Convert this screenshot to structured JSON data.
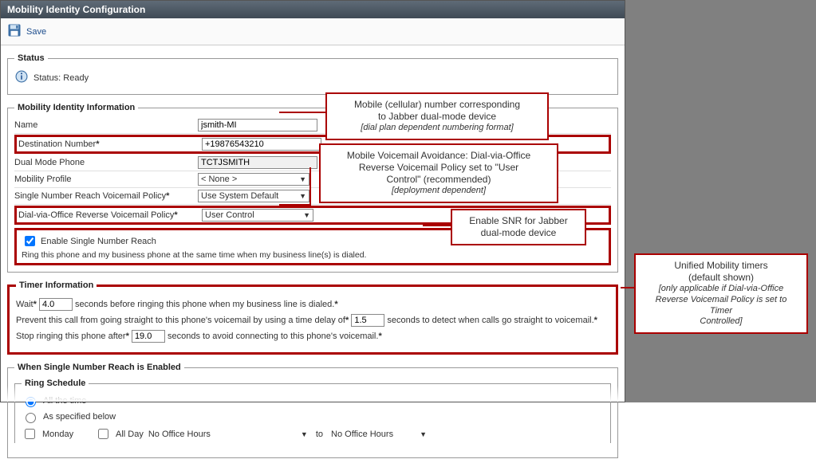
{
  "window": {
    "title": "Mobility Identity Configuration"
  },
  "toolbar": {
    "save_label": "Save"
  },
  "status": {
    "legend": "Status",
    "text": "Status: Ready"
  },
  "identity": {
    "legend": "Mobility Identity Information",
    "name_label": "Name",
    "name_value": "jsmith-MI",
    "dest_label": "Destination Number",
    "dest_value": "+19876543210",
    "dual_label": "Dual Mode Phone",
    "dual_value": "TCTJSMITH",
    "profile_label": "Mobility Profile",
    "profile_value": "< None >",
    "snr_vm_label": "Single Number Reach Voicemail Policy",
    "snr_vm_value": "Use System Default",
    "dvo_vm_label": "Dial-via-Office Reverse Voicemail Policy",
    "dvo_vm_value": "User Control",
    "enable_snr_label": "Enable Single Number Reach",
    "enable_snr_sub": "Ring this phone and my business phone at the same time when my business line(s) is dialed."
  },
  "timer": {
    "legend": "Timer Information",
    "wait_pre": "Wait",
    "wait_value": "4.0",
    "wait_post": "seconds before ringing this phone when my business line is dialed.",
    "prevent_pre": "Prevent this call from going straight to this phone's voicemail by using a time delay of",
    "prevent_value": "1.5",
    "prevent_post": "seconds to detect when calls go straight to voicemail.",
    "stop_pre": "Stop ringing this phone after",
    "stop_value": "19.0",
    "stop_post": "seconds to avoid connecting to this phone's voicemail."
  },
  "snr_enabled": {
    "legend": "When Single Number Reach is Enabled",
    "ring_legend": "Ring Schedule",
    "opt_all": "All the time",
    "opt_spec": "As specified below",
    "day_mon": "Monday",
    "allday": "All Day",
    "hours": "No Office Hours",
    "to": "to",
    "hours2": "No Office Hours"
  },
  "annotations": {
    "a1_l1": "Mobile (cellular) number corresponding",
    "a1_l2": "to Jabber dual-mode device",
    "a1_sub": "[dial plan dependent numbering format]",
    "a2_l1": "Mobile Voicemail Avoidance: Dial-via-Office",
    "a2_l2": "Reverse Voicemail Policy set to \"User",
    "a2_l3": "Control\" (recommended)",
    "a2_sub": "[deployment dependent]",
    "a3_l1": "Enable SNR for Jabber",
    "a3_l2": "dual-mode device",
    "a4_l1": "Unified Mobility timers",
    "a4_l2": "(default shown)",
    "a4_sub1": "[only applicable if Dial-via-Office",
    "a4_sub2": "Reverse Voicemail Policy is set to Timer",
    "a4_sub3": "Controlled]"
  }
}
